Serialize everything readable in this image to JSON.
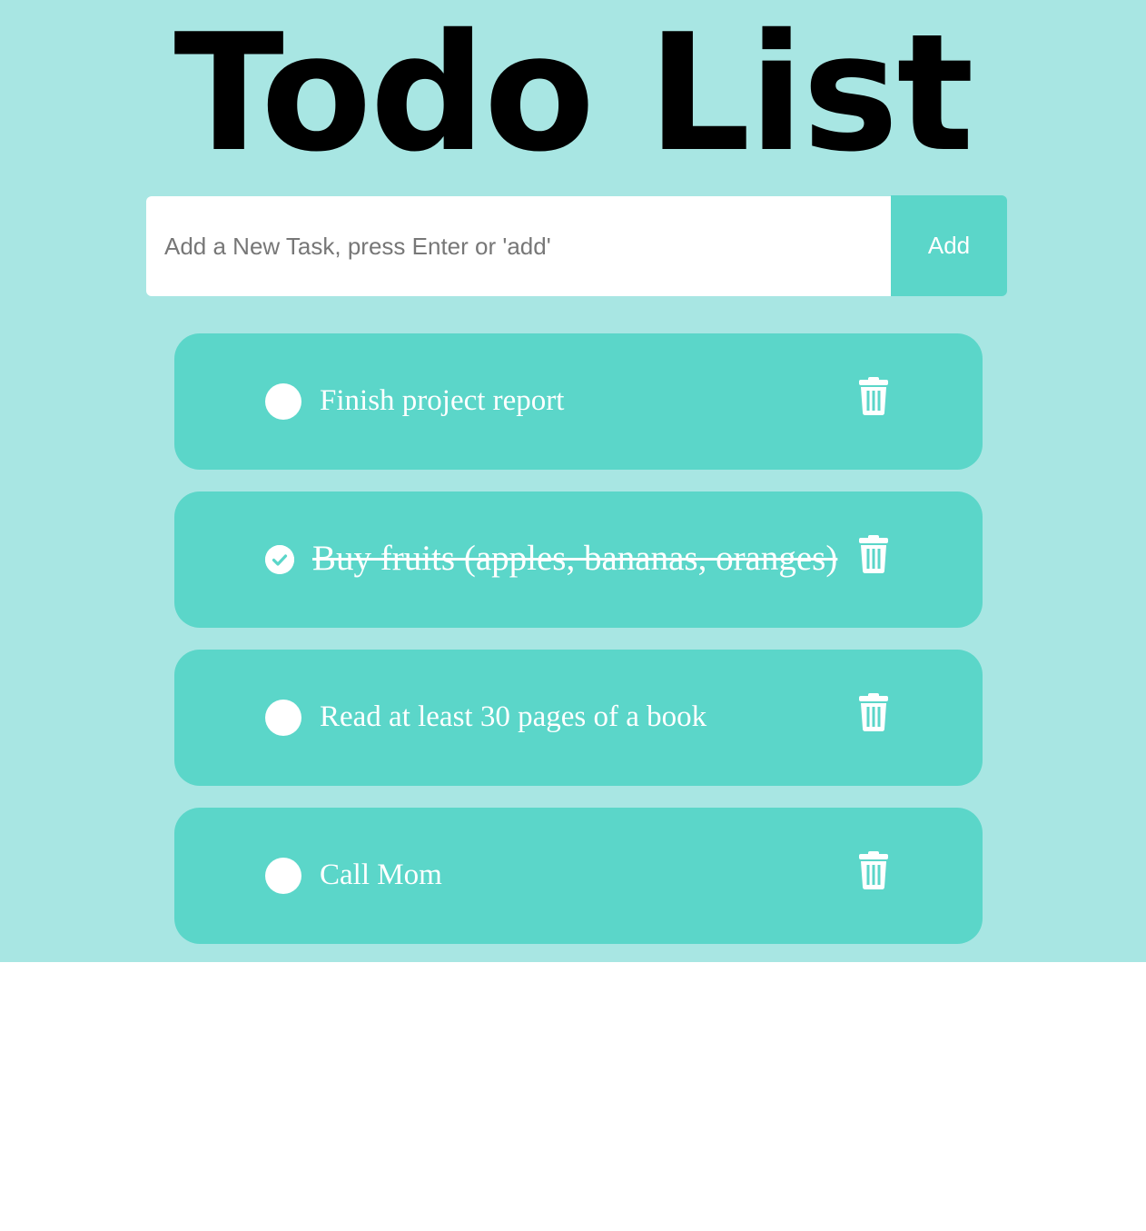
{
  "header": {
    "title": "Todo List"
  },
  "new_task": {
    "placeholder": "Add a New Task, press Enter or 'add'",
    "value": "",
    "add_label": "Add"
  },
  "tasks": [
    {
      "text": "Finish project report",
      "completed": false
    },
    {
      "text": "Buy fruits (apples, bananas, oranges)",
      "completed": true
    },
    {
      "text": "Read at least 30 pages of a book",
      "completed": false
    },
    {
      "text": "Call Mom",
      "completed": false
    }
  ],
  "icons": {
    "checkbox": "circle-icon",
    "checked": "check-circle-icon",
    "delete": "trash-icon"
  },
  "colors": {
    "background": "#a8e6e3",
    "accent": "#5bd6c9",
    "text_light": "#ffffff",
    "title": "#000000"
  }
}
